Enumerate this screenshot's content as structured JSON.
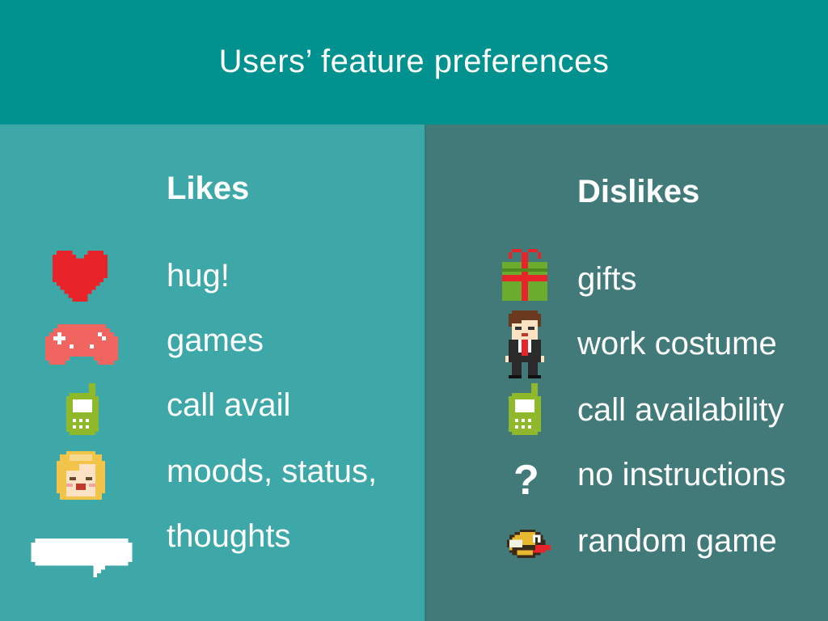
{
  "slide": {
    "title": "Users’ feature preferences"
  },
  "likes": {
    "heading": "Likes",
    "items": [
      {
        "label": "hug!",
        "icon": "heart-icon"
      },
      {
        "label": "games",
        "icon": "gamepad-icon"
      },
      {
        "label": "call avail",
        "icon": "phone-icon"
      },
      {
        "label": "moods, status,",
        "icon": "happy-face-icon"
      },
      {
        "label": "thoughts",
        "icon": "speech-bubble-icon"
      }
    ]
  },
  "dislikes": {
    "heading": "Dislikes",
    "items": [
      {
        "label": "gifts",
        "icon": "gift-icon"
      },
      {
        "label": "work costume",
        "icon": "businessman-icon"
      },
      {
        "label": "call availability",
        "icon": "phone-icon"
      },
      {
        "label": "no instructions",
        "icon": "question-mark-icon",
        "glyph": "?"
      },
      {
        "label": "random game",
        "icon": "flappy-bird-icon"
      }
    ]
  },
  "colors": {
    "header": "#019290",
    "likes_panel": "#3ea7a8",
    "dislikes_panel": "#427a79",
    "text": "#ffffff",
    "heart": "#e8242a",
    "gamepad": "#f0655f",
    "phone": "#8fb82a",
    "gift_box": "#6bab2e",
    "gift_ribbon": "#e8242a"
  }
}
